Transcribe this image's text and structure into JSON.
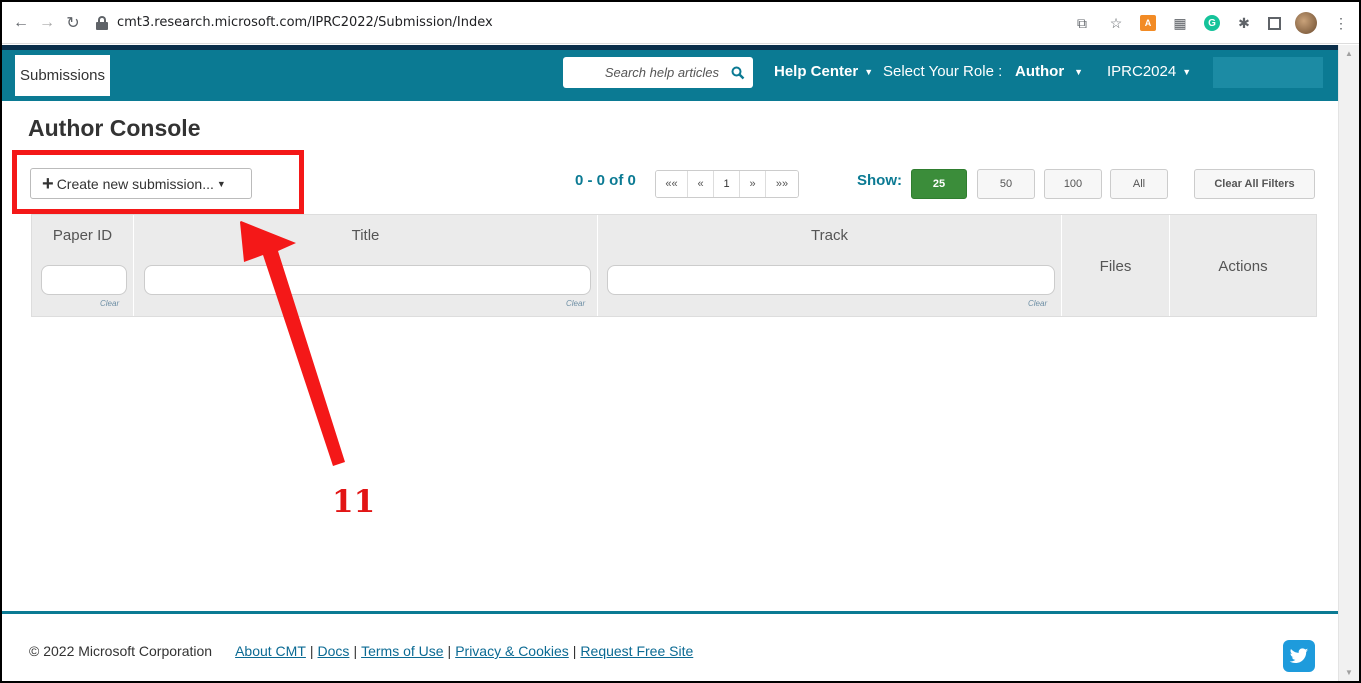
{
  "browser": {
    "url": "cmt3.research.microsoft.com/IPRC2022/Submission/Index"
  },
  "topbar": {
    "tab_label": "Submissions",
    "search_placeholder": "Search help articles",
    "help_center": "Help Center",
    "role_label": "Select Your Role :",
    "role_value": "Author",
    "conference": "IPRC2024"
  },
  "main": {
    "title": "Author Console",
    "create_button": "Create new submission...",
    "count": "0 - 0 of 0",
    "pager": [
      "««",
      "«",
      "1",
      "»",
      "»»"
    ],
    "show_label": "Show:",
    "show_options": [
      "25",
      "50",
      "100",
      "All"
    ],
    "show_selected": "25",
    "clear_filters": "Clear All Filters",
    "columns": {
      "paper_id": "Paper ID",
      "title": "Title",
      "track": "Track",
      "files": "Files",
      "actions": "Actions"
    },
    "clear_link": "Clear"
  },
  "annotation": {
    "step_number": "11",
    "color": "#f41818"
  },
  "footer": {
    "copyright": "© 2022 Microsoft Corporation",
    "links": [
      "About CMT",
      "Docs",
      "Terms of Use",
      "Privacy & Cookies",
      "Request Free Site"
    ]
  },
  "colors": {
    "brand": "#0b7a93",
    "active_show": "#3b8d3a"
  }
}
